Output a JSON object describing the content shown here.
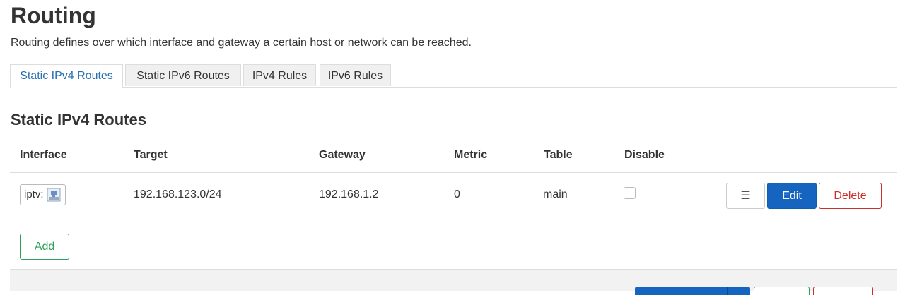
{
  "page": {
    "title": "Routing",
    "description": "Routing defines over which interface and gateway a certain host or network can be reached."
  },
  "tabs": [
    {
      "label": "Static IPv4 Routes",
      "active": true
    },
    {
      "label": "Static IPv6 Routes",
      "active": false
    },
    {
      "label": "IPv4 Rules",
      "active": false
    },
    {
      "label": "IPv6 Rules",
      "active": false
    }
  ],
  "section": {
    "title": "Static IPv4 Routes",
    "columns": [
      "Interface",
      "Target",
      "Gateway",
      "Metric",
      "Table",
      "Disable"
    ],
    "rows": [
      {
        "interface": "iptv:",
        "interface_icon": "network-port-icon",
        "target": "192.168.123.0/24",
        "gateway": "192.168.1.2",
        "metric": "0",
        "table": "main",
        "disabled": false,
        "actions": {
          "menu": "☰",
          "edit": "Edit",
          "delete": "Delete"
        }
      }
    ],
    "add_label": "Add"
  },
  "colors": {
    "accent": "#1565c0",
    "tab_active_text": "#2a6fb2",
    "success": "#2e9e5b",
    "danger": "#c9302c"
  }
}
